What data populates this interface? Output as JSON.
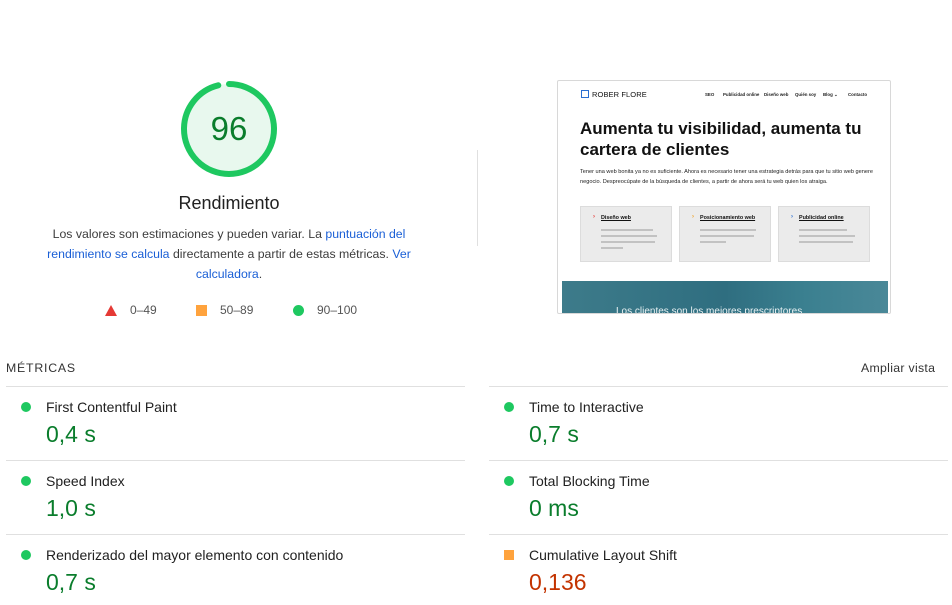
{
  "performance": {
    "score": "96",
    "score_fraction": 0.96,
    "title": "Rendimiento",
    "desc_text1": "Los valores son estimaciones y pueden variar. La ",
    "desc_link1": "puntuación del rendimiento se calcula",
    "desc_text2": " directamente a partir de estas métricas. ",
    "desc_link2": "Ver calculadora",
    "desc_text3": "."
  },
  "legend": [
    {
      "label": "0–49",
      "shape": "triangle",
      "color": "#e53935"
    },
    {
      "label": "50–89",
      "shape": "square",
      "color": "#ffa33d"
    },
    {
      "label": "90–100",
      "shape": "circle",
      "color": "#1ec860"
    }
  ],
  "preview": {
    "logo": "ROBER FLORE",
    "nav": [
      "SEO",
      "Publicidad online",
      "Diseño web",
      "Quién soy",
      "Blog",
      "Contacto"
    ],
    "nav_blog_caret": "⌄",
    "headline": "Aumenta tu visibilidad, aumenta tu cartera de clientes",
    "paragraph": "Tener una web bonita ya no es suficiente. Ahora es necesario tener una estrategia detrás para que tu sitio web genere negocio. Despreocúpate de la búsqueda de clientes, a partir de ahora será tu web quien los atraiga.",
    "cards": [
      {
        "title": "Diseño web",
        "chevron_color": "#e53935"
      },
      {
        "title": "Posicionamiento web",
        "chevron_color": "#f0a020"
      },
      {
        "title": "Publicidad online",
        "chevron_color": "#2a6fd1"
      }
    ],
    "banner_text": "Los clientes son los mejores prescriptores"
  },
  "metrics": {
    "title": "MÉTRICAS",
    "expand_label": "Ampliar vista",
    "items": [
      {
        "label": "First Contentful Paint",
        "value": "0,4 s",
        "status": "pass"
      },
      {
        "label": "Time to Interactive",
        "value": "0,7 s",
        "status": "pass"
      },
      {
        "label": "Speed Index",
        "value": "1,0 s",
        "status": "pass"
      },
      {
        "label": "Total Blocking Time",
        "value": "0 ms",
        "status": "pass"
      },
      {
        "label": "Renderizado del mayor elemento con contenido",
        "value": "0,7 s",
        "status": "pass"
      },
      {
        "label": "Cumulative Layout Shift",
        "value": "0,136",
        "status": "average"
      }
    ]
  },
  "colors": {
    "pass": "#1ec860",
    "pass_text": "#0a7d2c",
    "average": "#ffa33d",
    "fail_text": "#c33300",
    "link": "#1a5fd6"
  }
}
